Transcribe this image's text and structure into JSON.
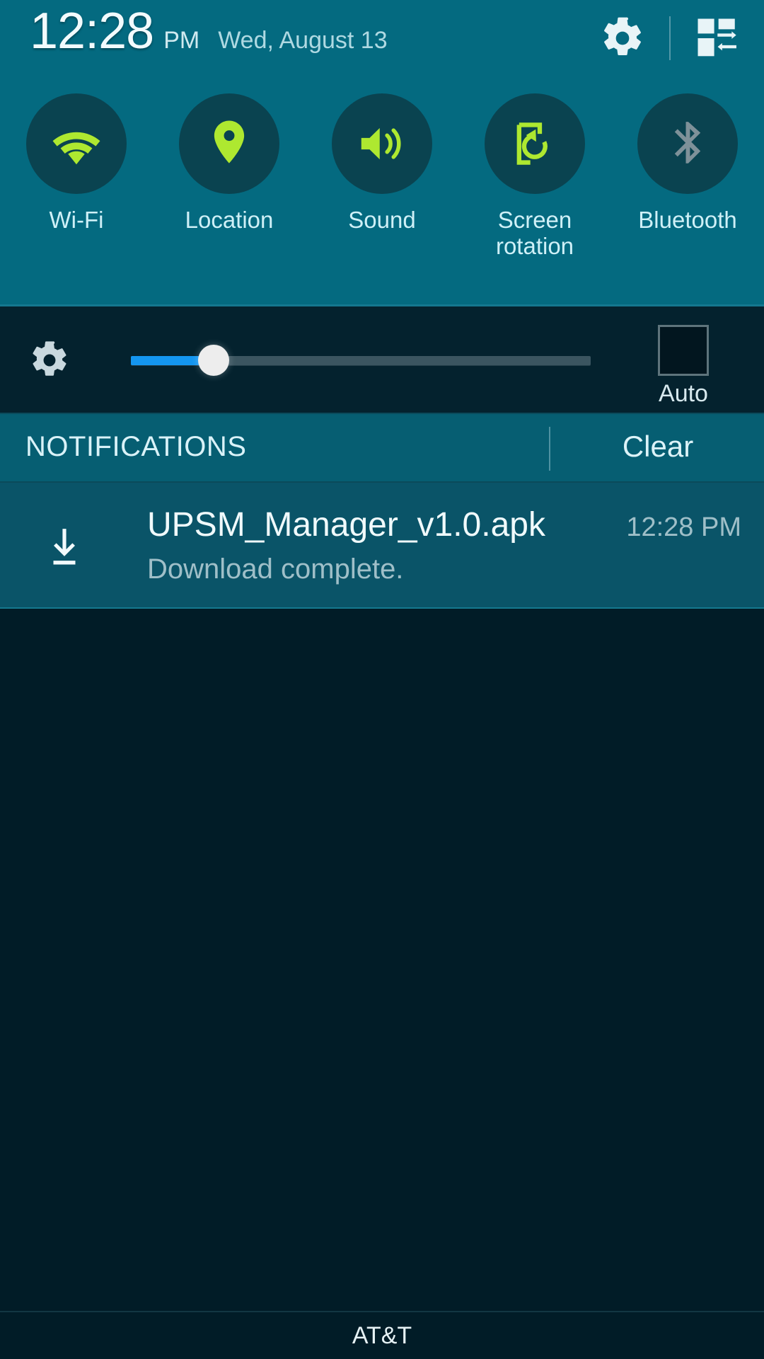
{
  "statusbar": {
    "time": "12:28",
    "ampm": "PM",
    "date": "Wed, August 13",
    "settings_icon": "gear-icon",
    "multiwindow_icon": "multi-window-icon"
  },
  "quick_settings": {
    "toggles": [
      {
        "label": "Wi-Fi",
        "icon": "wifi-icon",
        "state": "on"
      },
      {
        "label": "Location",
        "icon": "location-pin-icon",
        "state": "on"
      },
      {
        "label": "Sound",
        "icon": "sound-speaker-icon",
        "state": "on"
      },
      {
        "label": "Screen\nrotation",
        "icon": "screen-rotation-icon",
        "state": "on"
      },
      {
        "label": "Bluetooth",
        "icon": "bluetooth-icon",
        "state": "off"
      }
    ],
    "active_color": "#AEE830",
    "inactive_color": "#7E9199",
    "circle_color": "#0A4350",
    "panel_color": "#046A80"
  },
  "brightness": {
    "icon": "brightness-gear-icon",
    "value_percent": 18,
    "fill_color": "#1496F0",
    "auto_label": "Auto",
    "auto_checked": false
  },
  "notifications": {
    "header_title": "NOTIFICATIONS",
    "clear_label": "Clear",
    "items": [
      {
        "icon": "download-complete-icon",
        "title": "UPSM_Manager_v1.0.apk",
        "subtitle": "Download complete.",
        "time": "12:28 PM"
      }
    ]
  },
  "footer": {
    "carrier": "AT&T"
  }
}
